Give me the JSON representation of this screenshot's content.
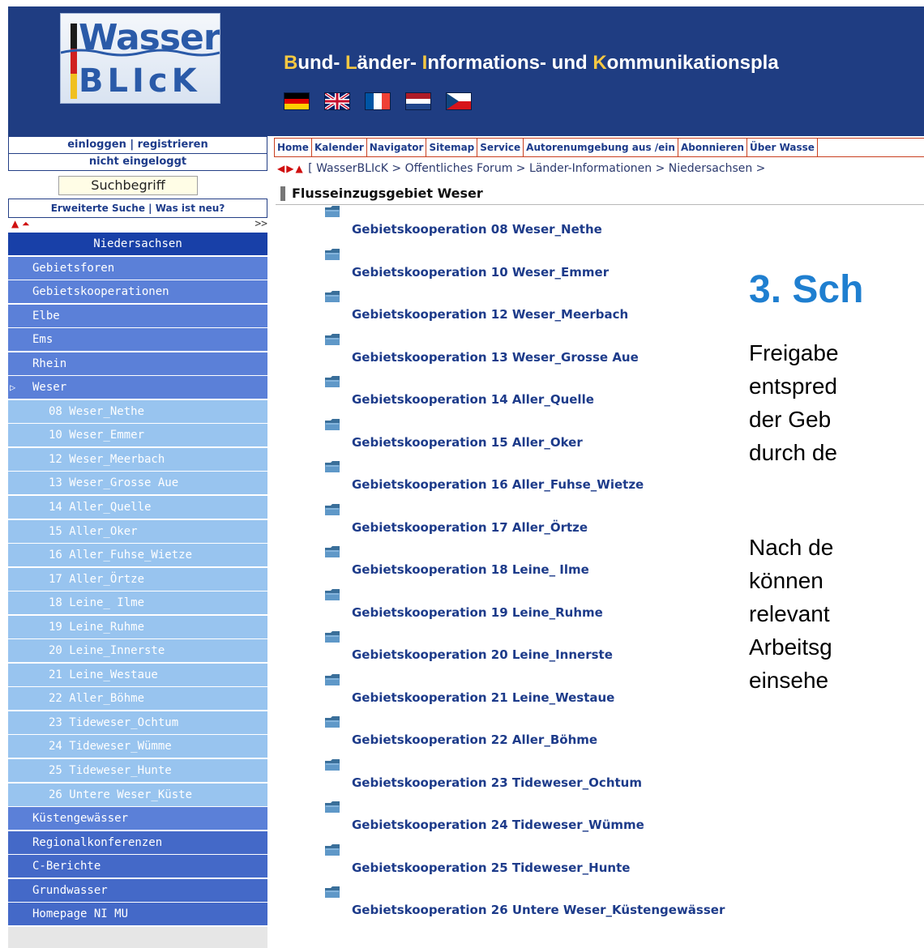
{
  "header": {
    "logo_top": "Wasser",
    "logo_bottom": "BLIcK",
    "tagline": [
      {
        "text": "B",
        "hl": true
      },
      {
        "text": "und- ",
        "hl": false
      },
      {
        "text": "L",
        "hl": true
      },
      {
        "text": "änder- ",
        "hl": false
      },
      {
        "text": "I",
        "hl": true
      },
      {
        "text": "nformations- und ",
        "hl": false
      },
      {
        "text": "K",
        "hl": true
      },
      {
        "text": "ommunikationspla",
        "hl": false
      }
    ],
    "flags": [
      "flag-germany",
      "flag-uk",
      "flag-france",
      "flag-netherlands",
      "flag-czech"
    ]
  },
  "left": {
    "login": "einloggen | registrieren",
    "status": "nicht eingeloggt",
    "search_value": "Suchbegriff",
    "advanced": "Erweiterte Suche |  Was ist neu?",
    "arrow_right": ">>",
    "nav": [
      {
        "label": "Niedersachsen",
        "level": "head"
      },
      {
        "label": "Gebietsforen",
        "level": "l1"
      },
      {
        "label": "Gebietskooperationen",
        "level": "l1"
      },
      {
        "label": "Elbe",
        "level": "l1b"
      },
      {
        "label": "Ems",
        "level": "l1b"
      },
      {
        "label": "Rhein",
        "level": "l1b"
      },
      {
        "label": "Weser",
        "level": "l1b",
        "active": true
      },
      {
        "label": "08 Weser_Nethe",
        "level": "l2"
      },
      {
        "label": "10 Weser_Emmer",
        "level": "l2"
      },
      {
        "label": "12 Weser_Meerbach",
        "level": "l2"
      },
      {
        "label": "13 Weser_Grosse Aue",
        "level": "l2"
      },
      {
        "label": "14 Aller_Quelle",
        "level": "l2"
      },
      {
        "label": "15 Aller_Oker",
        "level": "l2"
      },
      {
        "label": "16 Aller_Fuhse_Wietze",
        "level": "l2"
      },
      {
        "label": "17 Aller_Örtze",
        "level": "l2"
      },
      {
        "label": "18 Leine_ Ilme",
        "level": "l2"
      },
      {
        "label": "19 Leine_Ruhme",
        "level": "l2"
      },
      {
        "label": "20 Leine_Innerste",
        "level": "l2"
      },
      {
        "label": "21 Leine_Westaue",
        "level": "l2"
      },
      {
        "label": "22 Aller_Böhme",
        "level": "l2"
      },
      {
        "label": "23 Tideweser_Ochtum",
        "level": "l2"
      },
      {
        "label": "24 Tideweser_Wümme",
        "level": "l2"
      },
      {
        "label": "25 Tideweser_Hunte",
        "level": "l2"
      },
      {
        "label": "26 Untere Weser_Küste",
        "level": "l2"
      },
      {
        "label": "Küstengewässer",
        "level": "l1b"
      },
      {
        "label": "Regionalkonferenzen",
        "level": "top"
      },
      {
        "label": "C-Berichte",
        "level": "top"
      },
      {
        "label": "Grundwasser",
        "level": "top"
      },
      {
        "label": "Homepage NI MU",
        "level": "top"
      }
    ]
  },
  "navbar": [
    "Home",
    "Kalender",
    "Navigator",
    "Sitemap",
    "Service",
    "Autorenumgebung aus /ein",
    "Abonnieren",
    "Über Wasse"
  ],
  "breadcrumb": "[ WasserBLIcK > Öffentliches Forum > Länder-Informationen > Niedersachsen >",
  "section_title": "Flusseinzugsgebiet Weser",
  "folders": [
    "Gebietskooperation 08 Weser_Nethe",
    "Gebietskooperation 10 Weser_Emmer",
    "Gebietskooperation 12 Weser_Meerbach",
    "Gebietskooperation 13 Weser_Grosse Aue",
    "Gebietskooperation 14 Aller_Quelle",
    "Gebietskooperation 15 Aller_Oker",
    "Gebietskooperation 16 Aller_Fuhse_Wietze",
    "Gebietskooperation 17 Aller_Örtze",
    "Gebietskooperation 18 Leine_ Ilme",
    "Gebietskooperation 19 Leine_Ruhme",
    "Gebietskooperation 20 Leine_Innerste",
    "Gebietskooperation 21 Leine_Westaue",
    "Gebietskooperation 22 Aller_Böhme",
    "Gebietskooperation 23 Tideweser_Ochtum",
    "Gebietskooperation 24 Tideweser_Wümme",
    "Gebietskooperation 25 Tideweser_Hunte",
    "Gebietskooperation 26 Untere Weser_Küstengewässer"
  ],
  "slide": {
    "heading": "3. Sch",
    "para1": [
      "Freigabe",
      "entspred",
      "der Geb",
      "durch de"
    ],
    "para2": [
      "Nach de",
      "können",
      "relevant",
      "Arbeitsg",
      "einsehe"
    ]
  },
  "colors": {
    "header_bg": "#1f3d82",
    "nav_dark": "#1840a8",
    "nav_mid": "#5b80d8",
    "nav_light": "#98c4ef",
    "link_blue": "#1d3b8a",
    "heading_blue": "#1f7fd0",
    "navbar_border": "#c84020"
  }
}
